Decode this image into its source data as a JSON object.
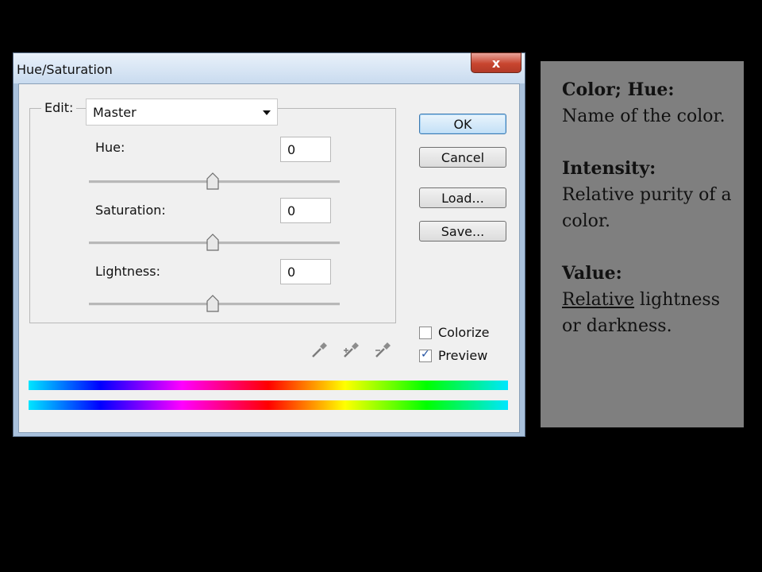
{
  "dialog": {
    "title": "Hue/Saturation",
    "close_label": "x",
    "edit": {
      "label": "Edit:",
      "value": "Master"
    },
    "fields": [
      {
        "label": "Hue:",
        "value": "0",
        "slider": 0.5
      },
      {
        "label": "Saturation:",
        "value": "0",
        "slider": 0.5
      },
      {
        "label": "Lightness:",
        "value": "0",
        "slider": 0.5
      }
    ],
    "buttons": {
      "ok": "OK",
      "cancel": "Cancel",
      "load": "Load...",
      "save": "Save..."
    },
    "checkboxes": {
      "colorize": {
        "label": "Colorize",
        "checked": false
      },
      "preview": {
        "label": "Preview",
        "checked": true
      }
    }
  },
  "info": {
    "hue_title": "Color; Hue:",
    "hue_text": "Name of the color.",
    "intensity_title": "Intensity:",
    "intensity_text": "Relative purity of a color.",
    "value_title": "Value:",
    "value_text_underlined": "Relative",
    "value_text_rest": " lightness or darkness."
  },
  "colors": {
    "accent": "#3b79b0",
    "panel_bg": "#7f7f7f",
    "close_button": "#c8452f"
  }
}
